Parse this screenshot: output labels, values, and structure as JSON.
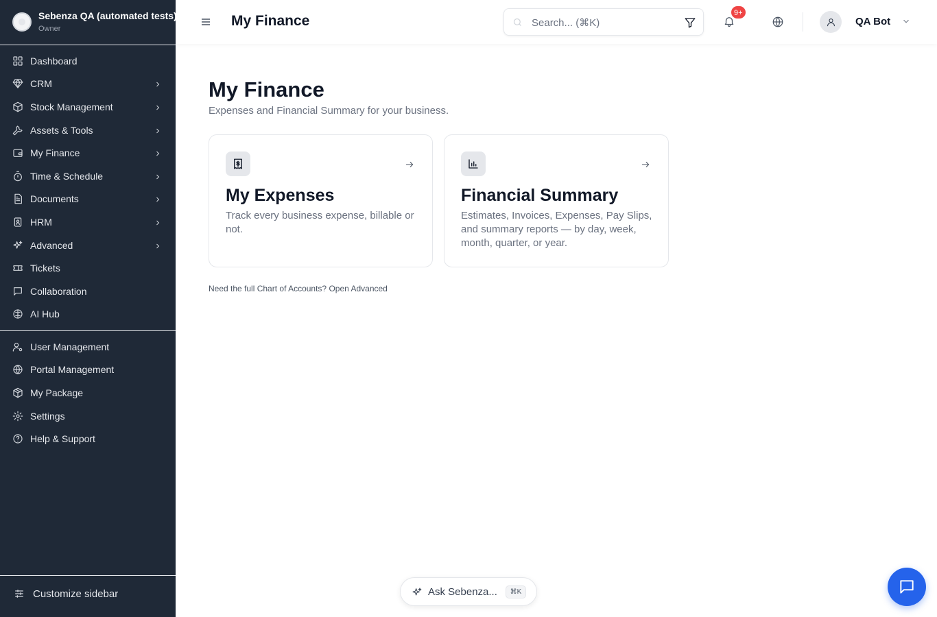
{
  "org": {
    "name": "Sebenza QA (automated tests)",
    "role": "Owner"
  },
  "sidebar": {
    "main": [
      {
        "label": "Dashboard",
        "icon": "dashboard-icon",
        "chevron": false
      },
      {
        "label": "CRM",
        "icon": "gem-icon",
        "chevron": true
      },
      {
        "label": "Stock Management",
        "icon": "box-icon",
        "chevron": true
      },
      {
        "label": "Assets & Tools",
        "icon": "wrench-icon",
        "chevron": true
      },
      {
        "label": "My Finance",
        "icon": "wallet-icon",
        "chevron": true
      },
      {
        "label": "Time & Schedule",
        "icon": "timer-icon",
        "chevron": true
      },
      {
        "label": "Documents",
        "icon": "document-icon",
        "chevron": true
      },
      {
        "label": "HRM",
        "icon": "id-card-icon",
        "chevron": true
      },
      {
        "label": "Advanced",
        "icon": "sparkles-icon",
        "chevron": true
      },
      {
        "label": "Tickets",
        "icon": "ticket-icon",
        "chevron": false
      },
      {
        "label": "Collaboration",
        "icon": "message-icon",
        "chevron": false
      },
      {
        "label": "AI Hub",
        "icon": "brain-icon",
        "chevron": false
      }
    ],
    "secondary": [
      {
        "label": "User Management",
        "icon": "user-cog-icon"
      },
      {
        "label": "Portal Management",
        "icon": "globe-icon"
      },
      {
        "label": "My Package",
        "icon": "package-icon"
      },
      {
        "label": "Settings",
        "icon": "gear-icon"
      },
      {
        "label": "Help & Support",
        "icon": "help-circle-icon"
      }
    ],
    "customize_label": "Customize sidebar"
  },
  "header": {
    "title": "My Finance",
    "search_placeholder": "Search... (⌘K)",
    "notification_count": "9+",
    "user_name": "QA Bot"
  },
  "main": {
    "title": "My Finance",
    "subtitle": "Expenses and Financial Summary for your business.",
    "cards": [
      {
        "title": "My Expenses",
        "description": "Track every business expense, billable or not.",
        "icon": "receipt-dollar-icon"
      },
      {
        "title": "Financial Summary",
        "description": "Estimates, Invoices, Expenses, Pay Slips, and summary reports — by day, week, month, quarter, or year.",
        "icon": "bar-chart-icon"
      }
    ],
    "footnote_text": "Need the full Chart of Accounts?",
    "footnote_link": "Open Advanced"
  },
  "ask": {
    "label": "Ask Sebenza...",
    "shortcut": "⌘K"
  },
  "colors": {
    "sidebar_bg": "#1f2937",
    "accent": "#2563eb",
    "badge": "#ef4444"
  }
}
